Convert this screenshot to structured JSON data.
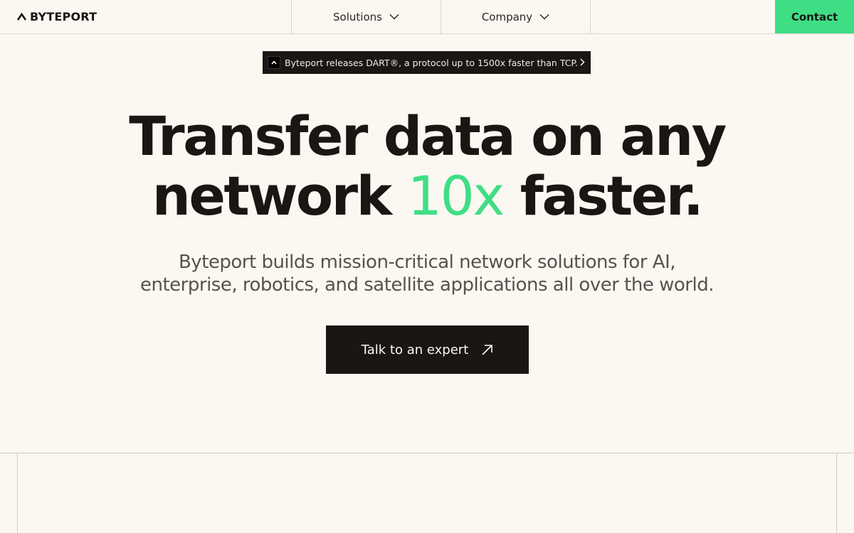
{
  "brand": {
    "name": "BYTEPORT",
    "logo_icon": "caret-up-icon"
  },
  "nav": {
    "items": [
      {
        "label": "Solutions",
        "icon": "chevron-down-icon"
      },
      {
        "label": "Company",
        "icon": "chevron-down-icon"
      }
    ],
    "contact_label": "Contact"
  },
  "announcement": {
    "text": "Byteport releases DART®, a protocol up to 1500x faster than TCP.",
    "icon": "caret-up-icon",
    "arrow_icon": "chevron-right-icon"
  },
  "hero": {
    "line1": "Transfer data on any",
    "line2_before": "network ",
    "line2_accent": "10x",
    "line2_after": " faster.",
    "subtitle_line1": "Byteport builds mission-critical network solutions for AI,",
    "subtitle_line2": "enterprise, robotics, and satellite applications all over the world."
  },
  "cta": {
    "label": "Talk to an expert",
    "icon": "arrow-up-right-icon"
  },
  "colors": {
    "background": "#fbf8f1",
    "accent": "#3fde85",
    "dark": "#1a1614",
    "muted_text": "#58524e"
  }
}
